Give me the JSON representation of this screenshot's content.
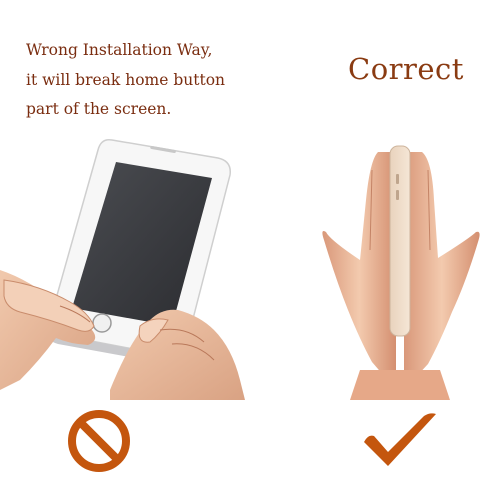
{
  "wrong": {
    "lines": [
      "Wrong Installation Way,",
      "it will break home button",
      "part of the screen."
    ]
  },
  "correct": {
    "label": "Correct"
  },
  "icons": {
    "wrong": "prohibited-icon",
    "correct": "checkmark-icon"
  },
  "colors": {
    "caption": "#7a2d10",
    "title": "#8a3b12",
    "symbol": "#c4560e"
  }
}
